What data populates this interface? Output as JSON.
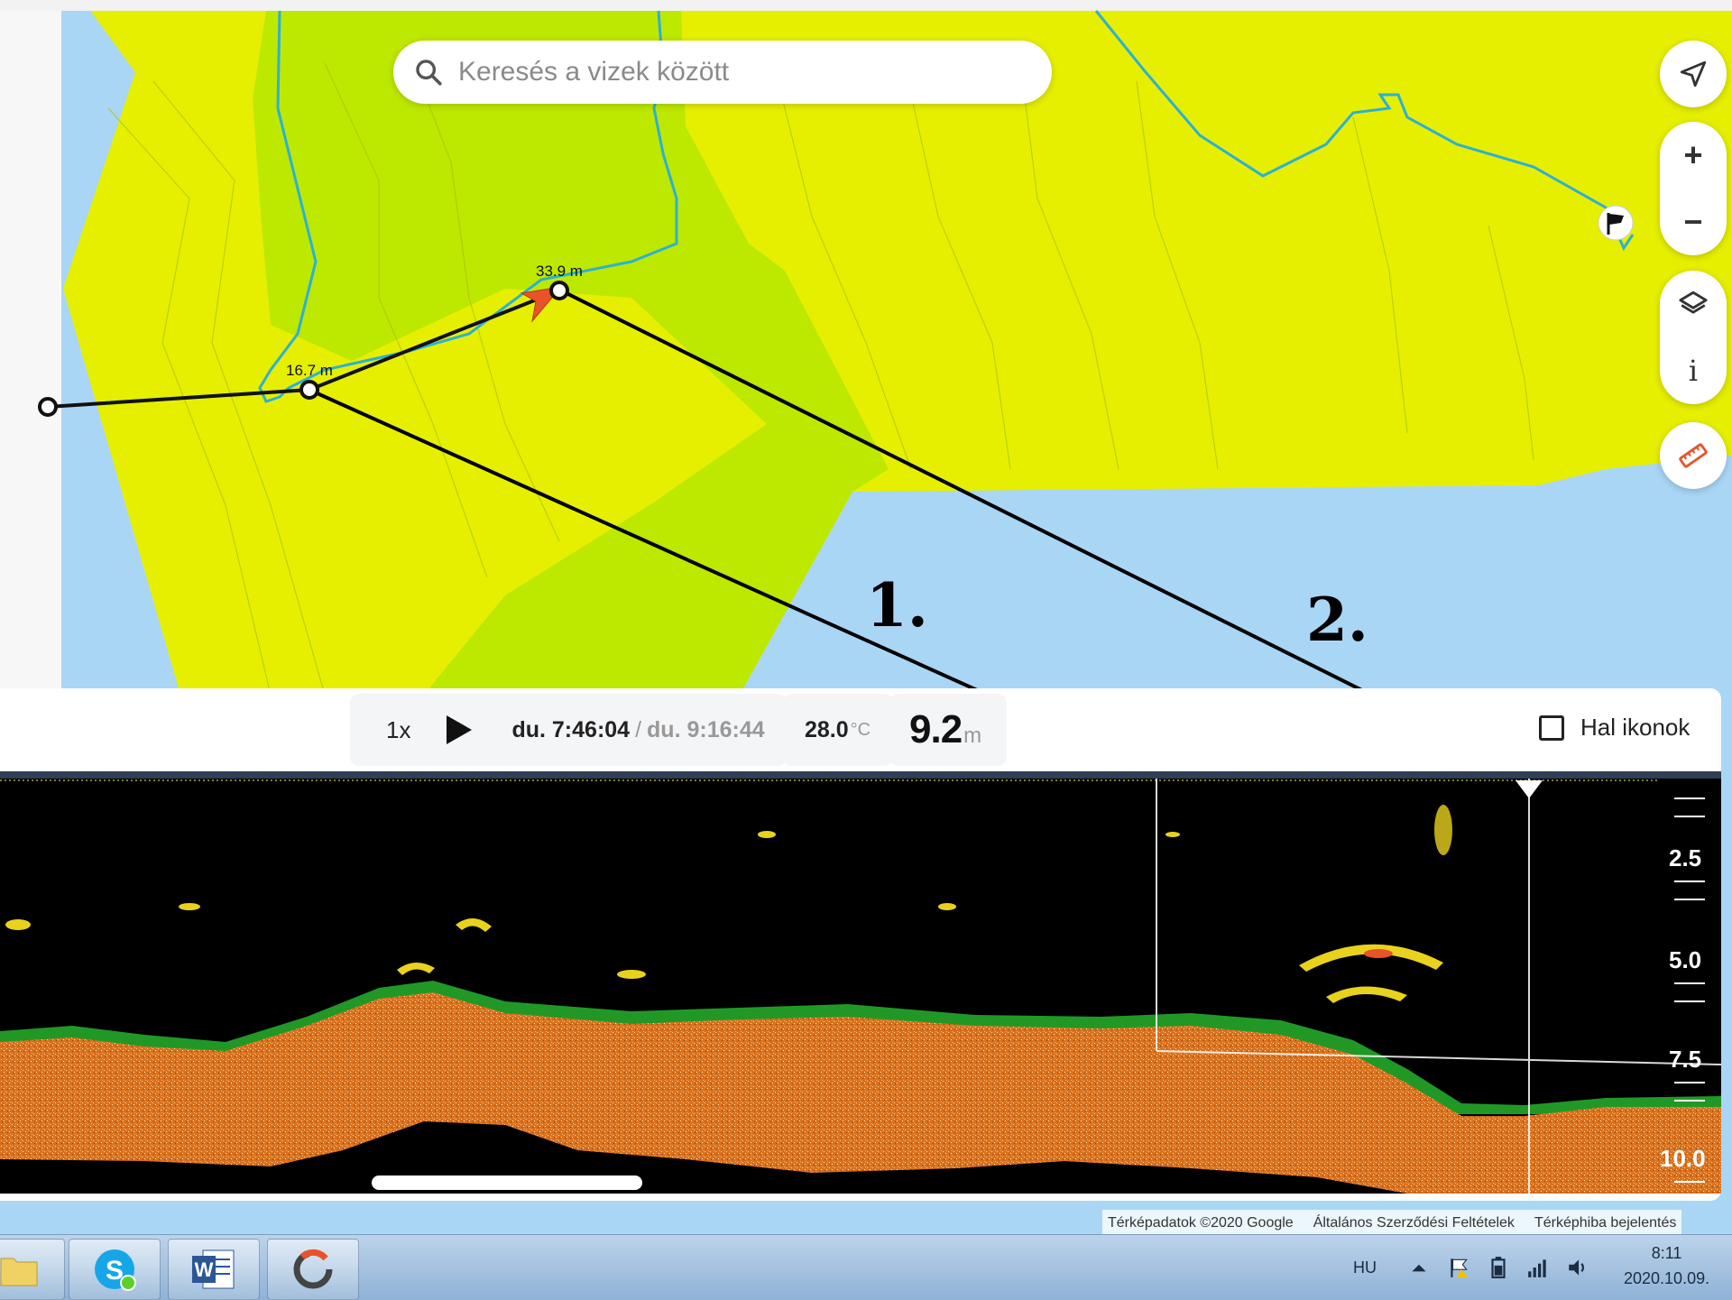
{
  "search": {
    "placeholder": "Keresés a vizek között"
  },
  "map_controls": {
    "locate": "navigation-arrow-icon",
    "zoom_in": "+",
    "zoom_out": "−",
    "layers": "layers-icon",
    "info": "i",
    "measure": "ruler-icon"
  },
  "map": {
    "waypoint_labels": [
      "16.7 m",
      "33.9 m"
    ],
    "annotations": [
      "1.",
      "2."
    ],
    "colors": {
      "water": "#a9d6f5",
      "shallow": "#e6ef00",
      "deep": "#bde800",
      "contour": "#2cb1d4",
      "route": "#111111",
      "boat": "#e8542a"
    }
  },
  "sonar_toolbar": {
    "speed": "1x",
    "time_current": "du. 7:46:04",
    "time_separator": "/",
    "time_total": "du. 9:16:44",
    "temperature": "28.0",
    "temperature_unit": "°C",
    "depth": "9.2",
    "depth_unit": "m",
    "fish_icons_label": "Hal ikonok",
    "fish_icons_checked": false
  },
  "sonar": {
    "depth_scale": [
      "2.5",
      "5.0",
      "7.5",
      "10.0"
    ],
    "colors": {
      "background": "#000000",
      "bottom": "#d9711e",
      "weeds": "#25a82a",
      "fish": "#e8d21e"
    }
  },
  "attribution": [
    "Térképadatok ©2020 Google",
    "Általános Szerződési Feltételek",
    "Térképhiba bejelentés"
  ],
  "taskbar": {
    "apps": [
      "file-explorer-icon",
      "skype-icon",
      "word-icon",
      "app-icon"
    ],
    "language": "HU",
    "time": "8:11",
    "date": "2020.10.09."
  }
}
